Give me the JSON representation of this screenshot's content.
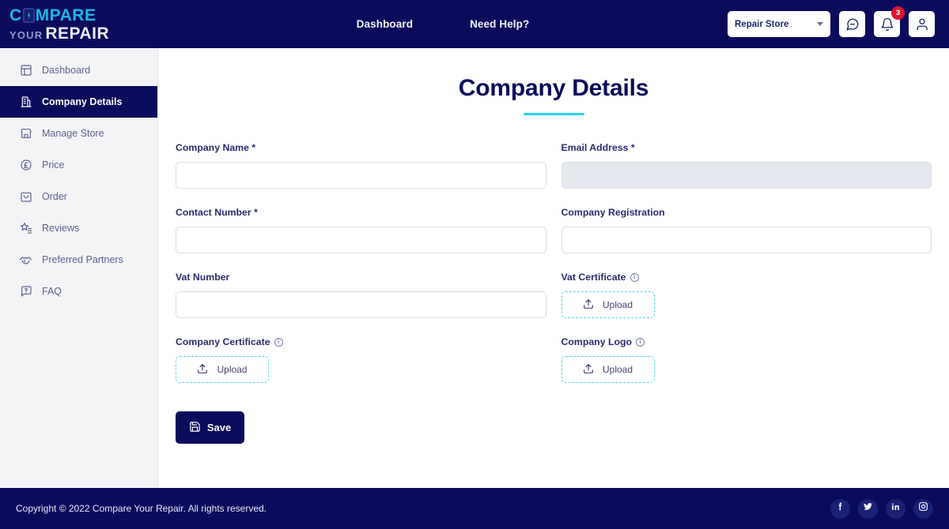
{
  "brand": {
    "logo_line1_a": "C",
    "logo_line1_b": "MPARE",
    "logo_your": "YOUR",
    "logo_repair": "REPAIR",
    "accent_cyan": "#18b9e8",
    "navy": "#0b0b5c"
  },
  "topnav": {
    "items": [
      {
        "label": "Dashboard"
      },
      {
        "label": "Need Help?"
      }
    ]
  },
  "topright": {
    "store_selected": "Repair Store",
    "notification_count": "3"
  },
  "sidebar": {
    "items": [
      {
        "label": "Dashboard",
        "icon": "dashboard-icon",
        "active": false
      },
      {
        "label": "Company Details",
        "icon": "building-icon",
        "active": true
      },
      {
        "label": "Manage Store",
        "icon": "store-icon",
        "active": false
      },
      {
        "label": "Price",
        "icon": "pound-coin-icon",
        "active": false
      },
      {
        "label": "Order",
        "icon": "bag-icon",
        "active": false
      },
      {
        "label": "Reviews",
        "icon": "star-list-icon",
        "active": false
      },
      {
        "label": "Preferred Partners",
        "icon": "handshake-icon",
        "active": false
      },
      {
        "label": "FAQ",
        "icon": "question-chat-icon",
        "active": false
      }
    ]
  },
  "main": {
    "title": "Company Details",
    "fields": {
      "company_name": {
        "label": "Company Name *",
        "value": "",
        "placeholder": ""
      },
      "email_address": {
        "label": "Email Address *",
        "value": "",
        "placeholder": "",
        "disabled": true
      },
      "contact_number": {
        "label": "Contact Number *",
        "value": "",
        "placeholder": ""
      },
      "company_registration": {
        "label": "Company Registration",
        "value": "",
        "placeholder": ""
      },
      "vat_number": {
        "label": "Vat Number",
        "value": "",
        "placeholder": ""
      },
      "vat_certificate": {
        "label": "Vat Certificate",
        "upload_label": "Upload",
        "has_info": true
      },
      "company_certificate": {
        "label": "Company Certificate",
        "upload_label": "Upload",
        "has_info": true
      },
      "company_logo": {
        "label": "Company Logo",
        "upload_label": "Upload",
        "has_info": true
      }
    },
    "save_label": "Save",
    "info_glyph": "i"
  },
  "footer": {
    "copyright": "Copyright © 2022 Compare Your Repair. All rights reserved.",
    "socials": [
      {
        "name": "facebook-icon"
      },
      {
        "name": "twitter-icon"
      },
      {
        "name": "linkedin-icon"
      },
      {
        "name": "instagram-icon"
      }
    ]
  }
}
